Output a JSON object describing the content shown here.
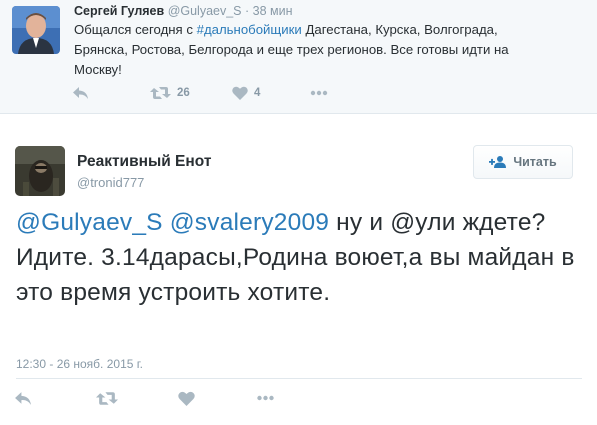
{
  "parent_tweet": {
    "name": "Сергей Гуляев",
    "handle": "@Gulyaev_S",
    "separator": "·",
    "time": "38 мин",
    "text_before": "Общался сегодня с ",
    "hashtag": "#дальнобойщики",
    "text_after": " Дагестана, Курска, Волгограда, Брянска, Ростова, Белгорода и еще трех регионов. Все готовы идти на Москву!",
    "retweet_count": "26",
    "like_count": "4",
    "icons": [
      "reply-icon",
      "retweet-icon",
      "heart-icon",
      "more-icon"
    ]
  },
  "main_tweet": {
    "name": "Реактивный Енот",
    "handle": "@tronid777",
    "follow_label": "Читать",
    "mention1": "@Gulyaev_S",
    "mention2": "@svalery2009",
    "text": " ну и @ули ждете?Идите. 3.14дарасы,Родина воюет,а вы майдан в это время устроить хотите.",
    "timestamp": "12:30 - 26 нояб. 2015 г.",
    "icons": [
      "reply-icon",
      "retweet-icon",
      "heart-icon",
      "more-icon"
    ]
  },
  "colors": {
    "link": "#2b7bb9",
    "muted": "#8899a6",
    "text": "#292f33",
    "parent_bg": "#f5f8fa",
    "border": "#e1e8ed"
  }
}
